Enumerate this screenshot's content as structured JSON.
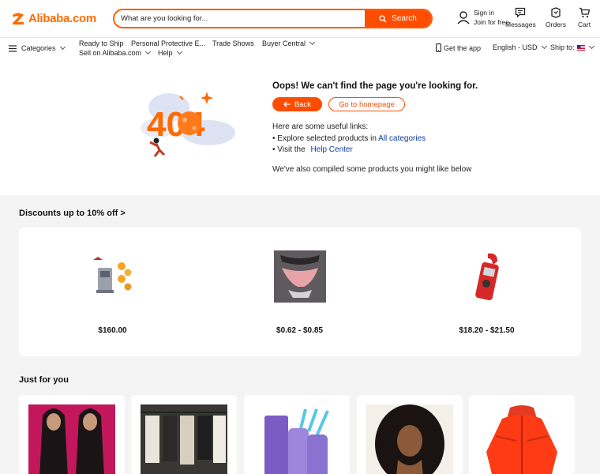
{
  "header": {
    "logo_text": "Alibaba.com",
    "search": {
      "placeholder": "What are you looking for...",
      "button_label": "Search"
    },
    "signin": {
      "line1": "Sign in",
      "line2": "Join for free"
    },
    "messages_label": "Messages",
    "orders_label": "Orders",
    "cart_label": "Cart",
    "brand_color": "#ff6a00"
  },
  "nav": {
    "categories_label": "Categories",
    "items": [
      {
        "label": "Ready to Ship"
      },
      {
        "label": "Personal Protective E..."
      },
      {
        "label": "Trade Shows"
      },
      {
        "label": "Buyer Central"
      },
      {
        "label": "Sell on Alibaba.com"
      },
      {
        "label": "Help"
      }
    ],
    "get_app_label": "Get the app",
    "language_label": "English - USD",
    "ship_to_label": "Ship to:"
  },
  "error": {
    "illustration_text": "404",
    "title": "Oops! We can't find the page you're looking for.",
    "back_label": "Back",
    "home_label": "Go to homepage",
    "links_heading": "Here are some useful links:",
    "link1_prefix": "• Explore selected products in",
    "link1_text": "All categories",
    "link2_prefix": "• Visit the",
    "link2_text": "Help Center",
    "compiled_text": "We've also compiled some products you might like below"
  },
  "discounts": {
    "title": "Discounts up to 10% off >",
    "items": [
      {
        "price": "$160.00",
        "icon": "machine-product-icon"
      },
      {
        "price": "$0.62 - $0.85",
        "icon": "underwear-product-icon"
      },
      {
        "price": "$18.20 - $21.50",
        "icon": "clamp-meter-product-icon"
      }
    ]
  },
  "just_for_you": {
    "title": "Just for you",
    "items": [
      {
        "icon": "wig-product-icon"
      },
      {
        "icon": "clothing-rack-product-icon"
      },
      {
        "icon": "tumbler-product-icon"
      },
      {
        "icon": "curly-wig-product-icon"
      },
      {
        "icon": "jacket-product-icon"
      }
    ]
  }
}
